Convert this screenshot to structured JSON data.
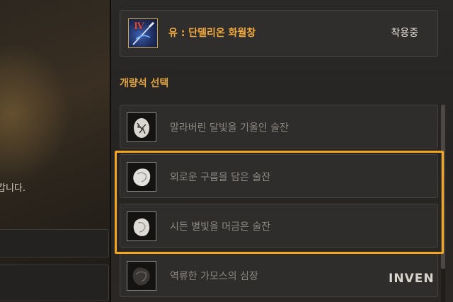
{
  "left_panel": {
    "text": "갑니다."
  },
  "equipped": {
    "name": "유 : 단델리온 화월창",
    "status": "착용중",
    "tier_badge": "Ⅳ"
  },
  "section_title": "개량석 선택",
  "items": [
    {
      "label": "말라버린 달빛을 기울인 술잔",
      "icon": "cracked-white-stone-icon"
    },
    {
      "label": "외로운 구름을 담은 술잔",
      "icon": "white-stone-icon"
    },
    {
      "label": "시든 별빛을 머금은 술잔",
      "icon": "white-stone-icon"
    },
    {
      "label": "역류한 가모스의 심장",
      "icon": "dark-heart-icon"
    }
  ],
  "highlight_color": "#f4a51c",
  "accent_color": "#e0a23e",
  "watermark": "INVEN"
}
